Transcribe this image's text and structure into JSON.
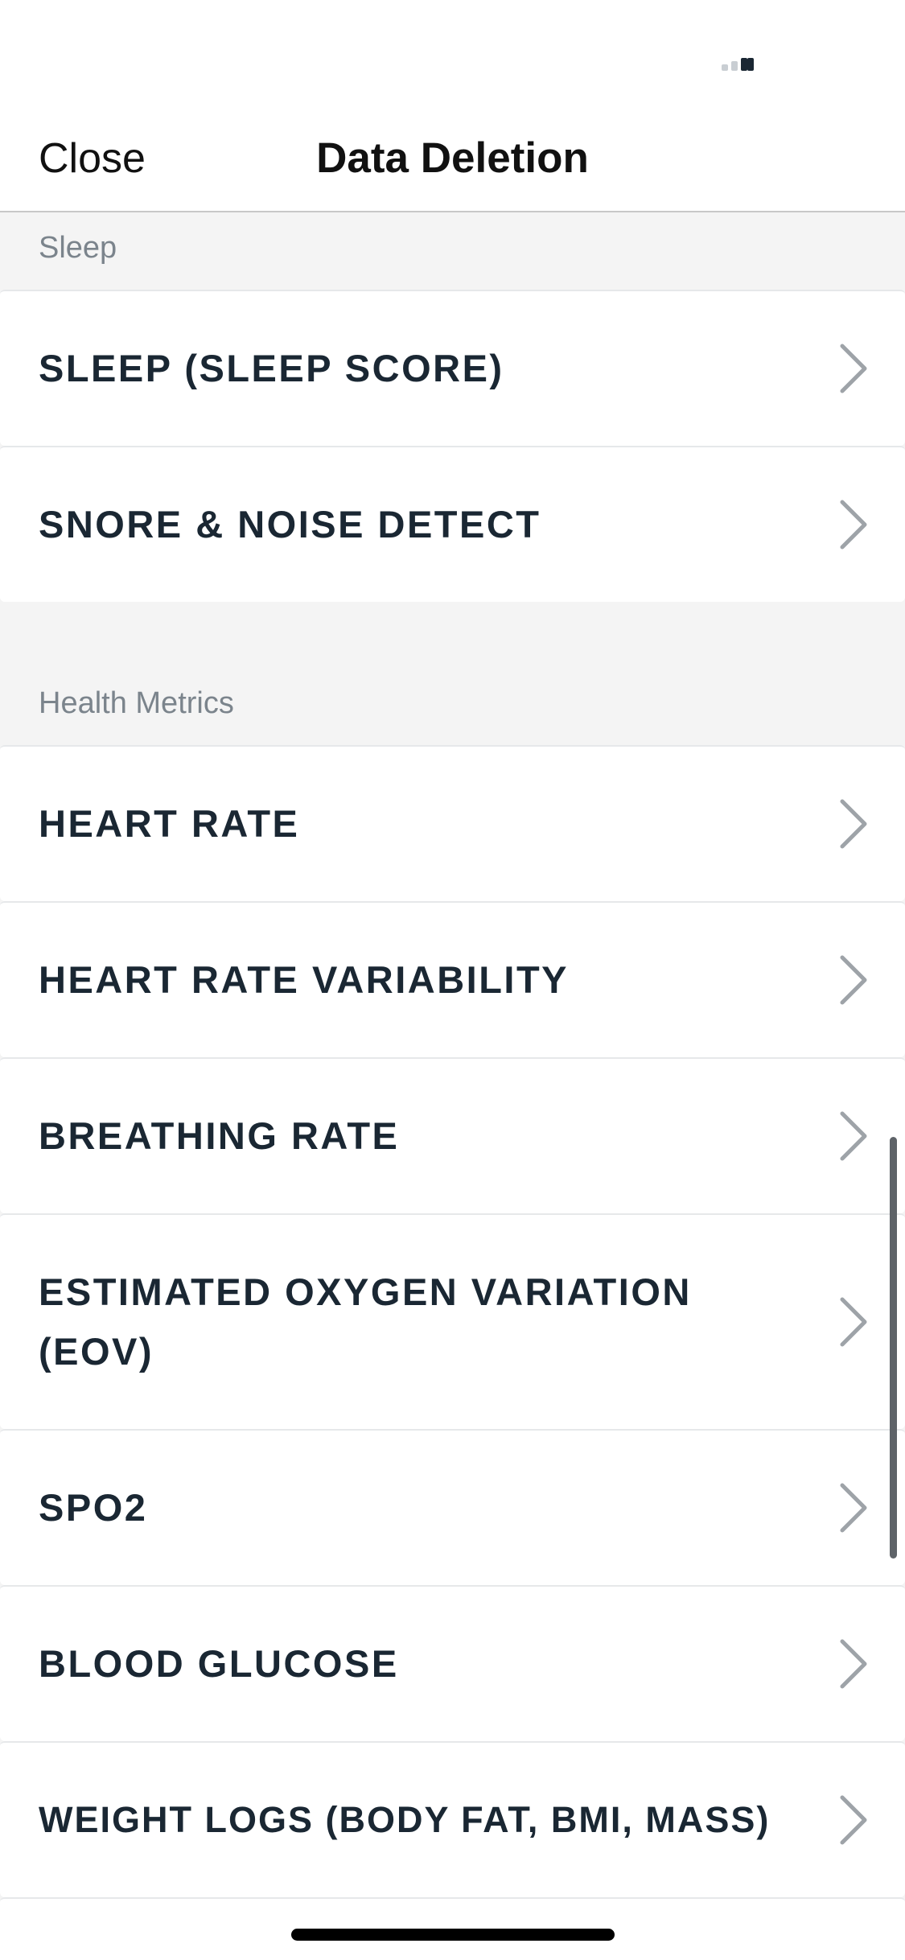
{
  "nav": {
    "close_label": "Close",
    "title": "Data Deletion"
  },
  "sections": [
    {
      "header": "Sleep",
      "items": [
        {
          "label": "SLEEP (SLEEP SCORE)"
        },
        {
          "label": "SNORE & NOISE DETECT"
        }
      ]
    },
    {
      "header": "Health Metrics",
      "items": [
        {
          "label": "HEART RATE"
        },
        {
          "label": "HEART RATE VARIABILITY"
        },
        {
          "label": "BREATHING RATE"
        },
        {
          "label": "ESTIMATED OXYGEN VARIATION (EOV)"
        },
        {
          "label": "SPO2"
        },
        {
          "label": "BLOOD GLUCOSE"
        },
        {
          "label": "WEIGHT LOGS (BODY FAT, BMI, MASS)"
        }
      ]
    }
  ],
  "icons": {
    "row_chevron": "chevron-right-icon",
    "signal": "signal-strength-icon"
  },
  "colors": {
    "text_primary": "#1a2733",
    "section_header_text": "#7b848c",
    "background": "#f4f4f4",
    "chevron": "#9ea3a8"
  }
}
